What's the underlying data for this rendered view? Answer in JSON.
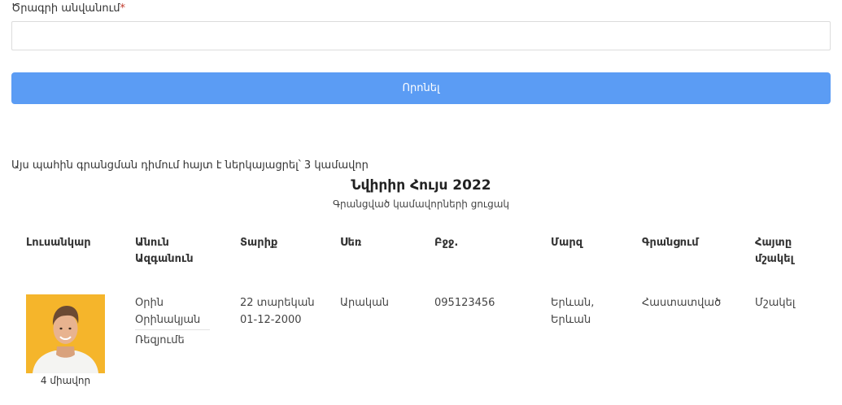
{
  "form": {
    "label": "Ծրագրի անվանում",
    "required_mark": "*",
    "input_value": "",
    "search_label": "Որոնել"
  },
  "summary_text": "Այս պահին գրանցման դիմում հայտ է ներկայացրել՝ 3 կամավոր",
  "program": {
    "title": "Նվիրիր Հույս 2022",
    "subtitle": "Գրանցված կամավորների ցուցակ"
  },
  "table": {
    "headers": [
      "Լուսանկար",
      "Անուն Ազգանուն",
      "Տարիք",
      "Սեռ",
      "Բջջ.",
      "Մարզ",
      "Գրանցում",
      "Հայտը մշակել"
    ],
    "rows": [
      {
        "photo_caption": "4 միավոր",
        "name": "Օրին Օրինակյան",
        "resume_link": "Ռեզյումե",
        "age": "22 տարեկան",
        "birthdate": "01-12-2000",
        "gender": "Արական",
        "phone": "095123456",
        "region": "Երևան, Երևան",
        "registration": "Հաստատված",
        "action": "Մշակել"
      }
    ]
  },
  "colors": {
    "button": "#5b9cf4",
    "photo_bg": "#f5b52b",
    "required": "#c0392b"
  }
}
